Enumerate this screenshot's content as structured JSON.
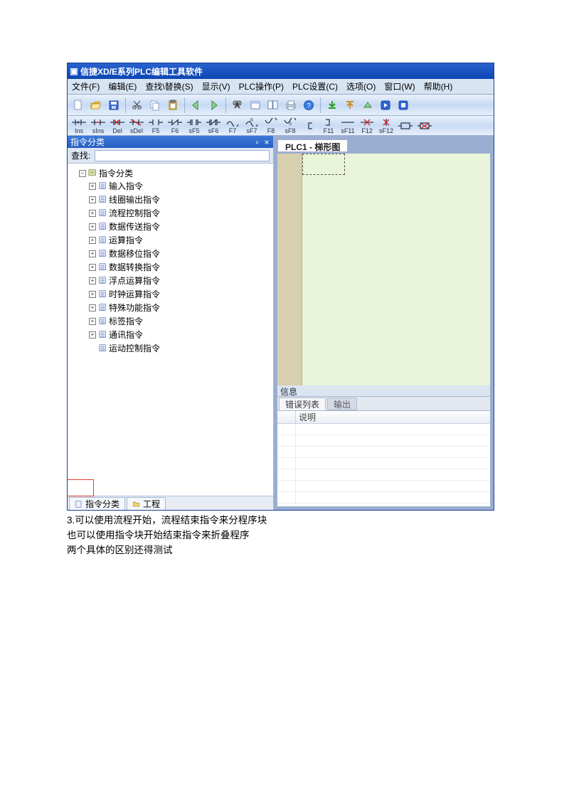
{
  "app_title": "信捷XD/E系列PLC编辑工具软件",
  "menus": [
    "文件(F)",
    "编辑(E)",
    "查找\\替换(S)",
    "显示(V)",
    "PLC操作(P)",
    "PLC设置(C)",
    "选项(O)",
    "窗口(W)",
    "帮助(H)"
  ],
  "toolbar1_names": [
    "new",
    "open",
    "save",
    "cut",
    "copy",
    "paste",
    "back",
    "forward",
    "find",
    "window",
    "tile",
    "print",
    "help",
    "download",
    "upload",
    "up",
    "run",
    "stop"
  ],
  "symbols": [
    {
      "k": "ins",
      "l": "Ins"
    },
    {
      "k": "sins",
      "l": "sIns"
    },
    {
      "k": "del",
      "l": "Del"
    },
    {
      "k": "sdel",
      "l": "sDel"
    },
    {
      "k": "no",
      "l": "F5"
    },
    {
      "k": "nc",
      "l": "F6"
    },
    {
      "k": "nop",
      "l": "sF5"
    },
    {
      "k": "ncp",
      "l": "sF6"
    },
    {
      "k": "up",
      "l": "F7"
    },
    {
      "k": "upn",
      "l": "sF7"
    },
    {
      "k": "dn",
      "l": "F8"
    },
    {
      "k": "dnn",
      "l": "sF8"
    },
    {
      "k": "lbr",
      "l": ""
    },
    {
      "k": "rbr",
      "l": "F11"
    },
    {
      "k": "hline",
      "l": "sF11"
    },
    {
      "k": "hdel",
      "l": "F12"
    },
    {
      "k": "vdel",
      "l": "sF12"
    },
    {
      "k": "box",
      "l": ""
    },
    {
      "k": "boxx",
      "l": ""
    }
  ],
  "left_panel": {
    "title": "指令分类",
    "search_label": "查找:",
    "root": "指令分类",
    "children": [
      "输入指令",
      "线圈输出指令",
      "流程控制指令",
      "数据传送指令",
      "运算指令",
      "数据移位指令",
      "数据转换指令",
      "浮点运算指令",
      "时钟运算指令",
      "特殊功能指令",
      "标签指令",
      "通讯指令",
      "运动控制指令"
    ],
    "tabs": [
      "指令分类",
      "工程"
    ]
  },
  "doc_title": "PLC1 - 梯形图",
  "info": {
    "title": "信息",
    "tabs": [
      "错误列表",
      "输出"
    ],
    "col_header": "说明"
  },
  "notes": [
    "3.可以使用流程开始，流程结束指令来分程序块",
    "  也可以使用指令块开始结束指令来折叠程序",
    "两个具体的区别还得测试"
  ]
}
